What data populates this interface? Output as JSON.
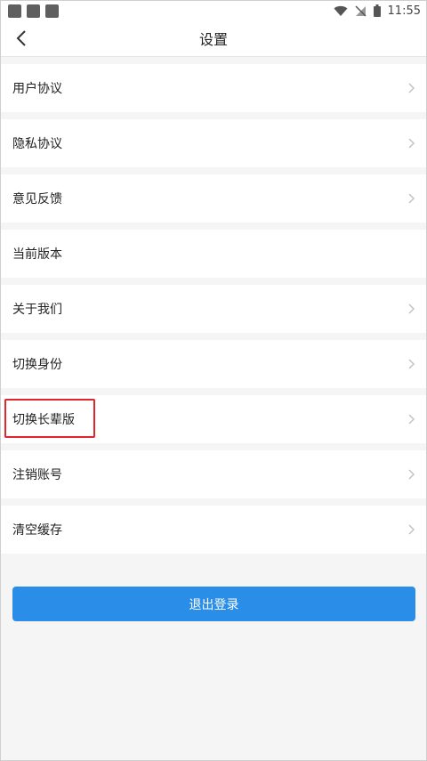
{
  "status_bar": {
    "time": "11:55"
  },
  "header": {
    "title": "设置"
  },
  "menu": [
    {
      "label": "用户协议",
      "chevron": true
    },
    {
      "label": "隐私协议",
      "chevron": true
    },
    {
      "label": "意见反馈",
      "chevron": true
    },
    {
      "label": "当前版本",
      "chevron": false
    },
    {
      "label": "关于我们",
      "chevron": true
    },
    {
      "label": "切换身份",
      "chevron": true
    },
    {
      "label": "切换长辈版",
      "chevron": true,
      "highlighted": true
    },
    {
      "label": "注销账号",
      "chevron": true
    },
    {
      "label": "清空缓存",
      "chevron": true
    }
  ],
  "logout_button": {
    "label": "退出登录"
  },
  "colors": {
    "accent": "#2a8ee8",
    "highlight": "#e3242b"
  }
}
